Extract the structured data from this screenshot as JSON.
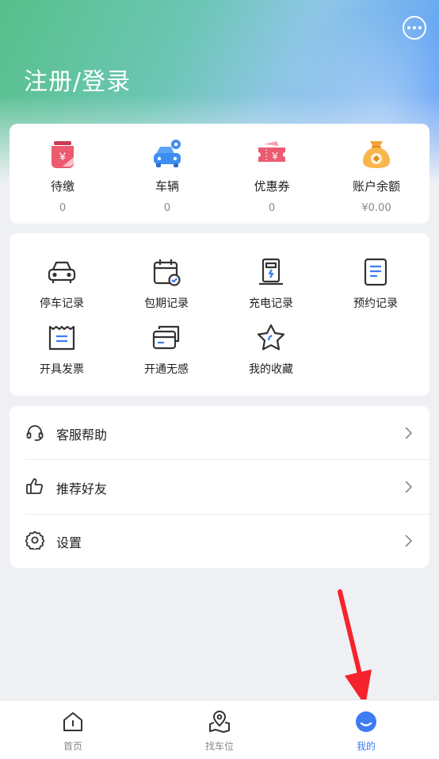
{
  "header": {
    "title": "注册/登录",
    "chat_icon": "more-chat-icon"
  },
  "stats": [
    {
      "label": "待缴",
      "value": "0",
      "icon": "pending-payment-icon"
    },
    {
      "label": "车辆",
      "value": "0",
      "icon": "car-location-icon"
    },
    {
      "label": "优惠券",
      "value": "0",
      "icon": "coupon-icon"
    },
    {
      "label": "账户余额",
      "value": "¥0.00",
      "icon": "money-bag-icon"
    }
  ],
  "services": [
    {
      "label": "停车记录",
      "icon": "car-icon"
    },
    {
      "label": "包期记录",
      "icon": "calendar-check-icon"
    },
    {
      "label": "充电记录",
      "icon": "charging-station-icon"
    },
    {
      "label": "预约记录",
      "icon": "document-icon"
    },
    {
      "label": "开具发票",
      "icon": "invoice-icon"
    },
    {
      "label": "开通无感",
      "icon": "card-icon"
    },
    {
      "label": "我的收藏",
      "icon": "star-icon"
    }
  ],
  "menu": [
    {
      "label": "客服帮助",
      "icon": "headset-icon"
    },
    {
      "label": "推荐好友",
      "icon": "thumbs-up-icon"
    },
    {
      "label": "设置",
      "icon": "gear-icon"
    }
  ],
  "tabbar": [
    {
      "label": "首页",
      "icon": "home-icon"
    },
    {
      "label": "找车位",
      "icon": "map-pin-icon"
    },
    {
      "label": "我的",
      "icon": "profile-icon",
      "active": true
    }
  ],
  "colors": {
    "accent": "#3d7cf2",
    "annotation_arrow": "#f5232b"
  }
}
